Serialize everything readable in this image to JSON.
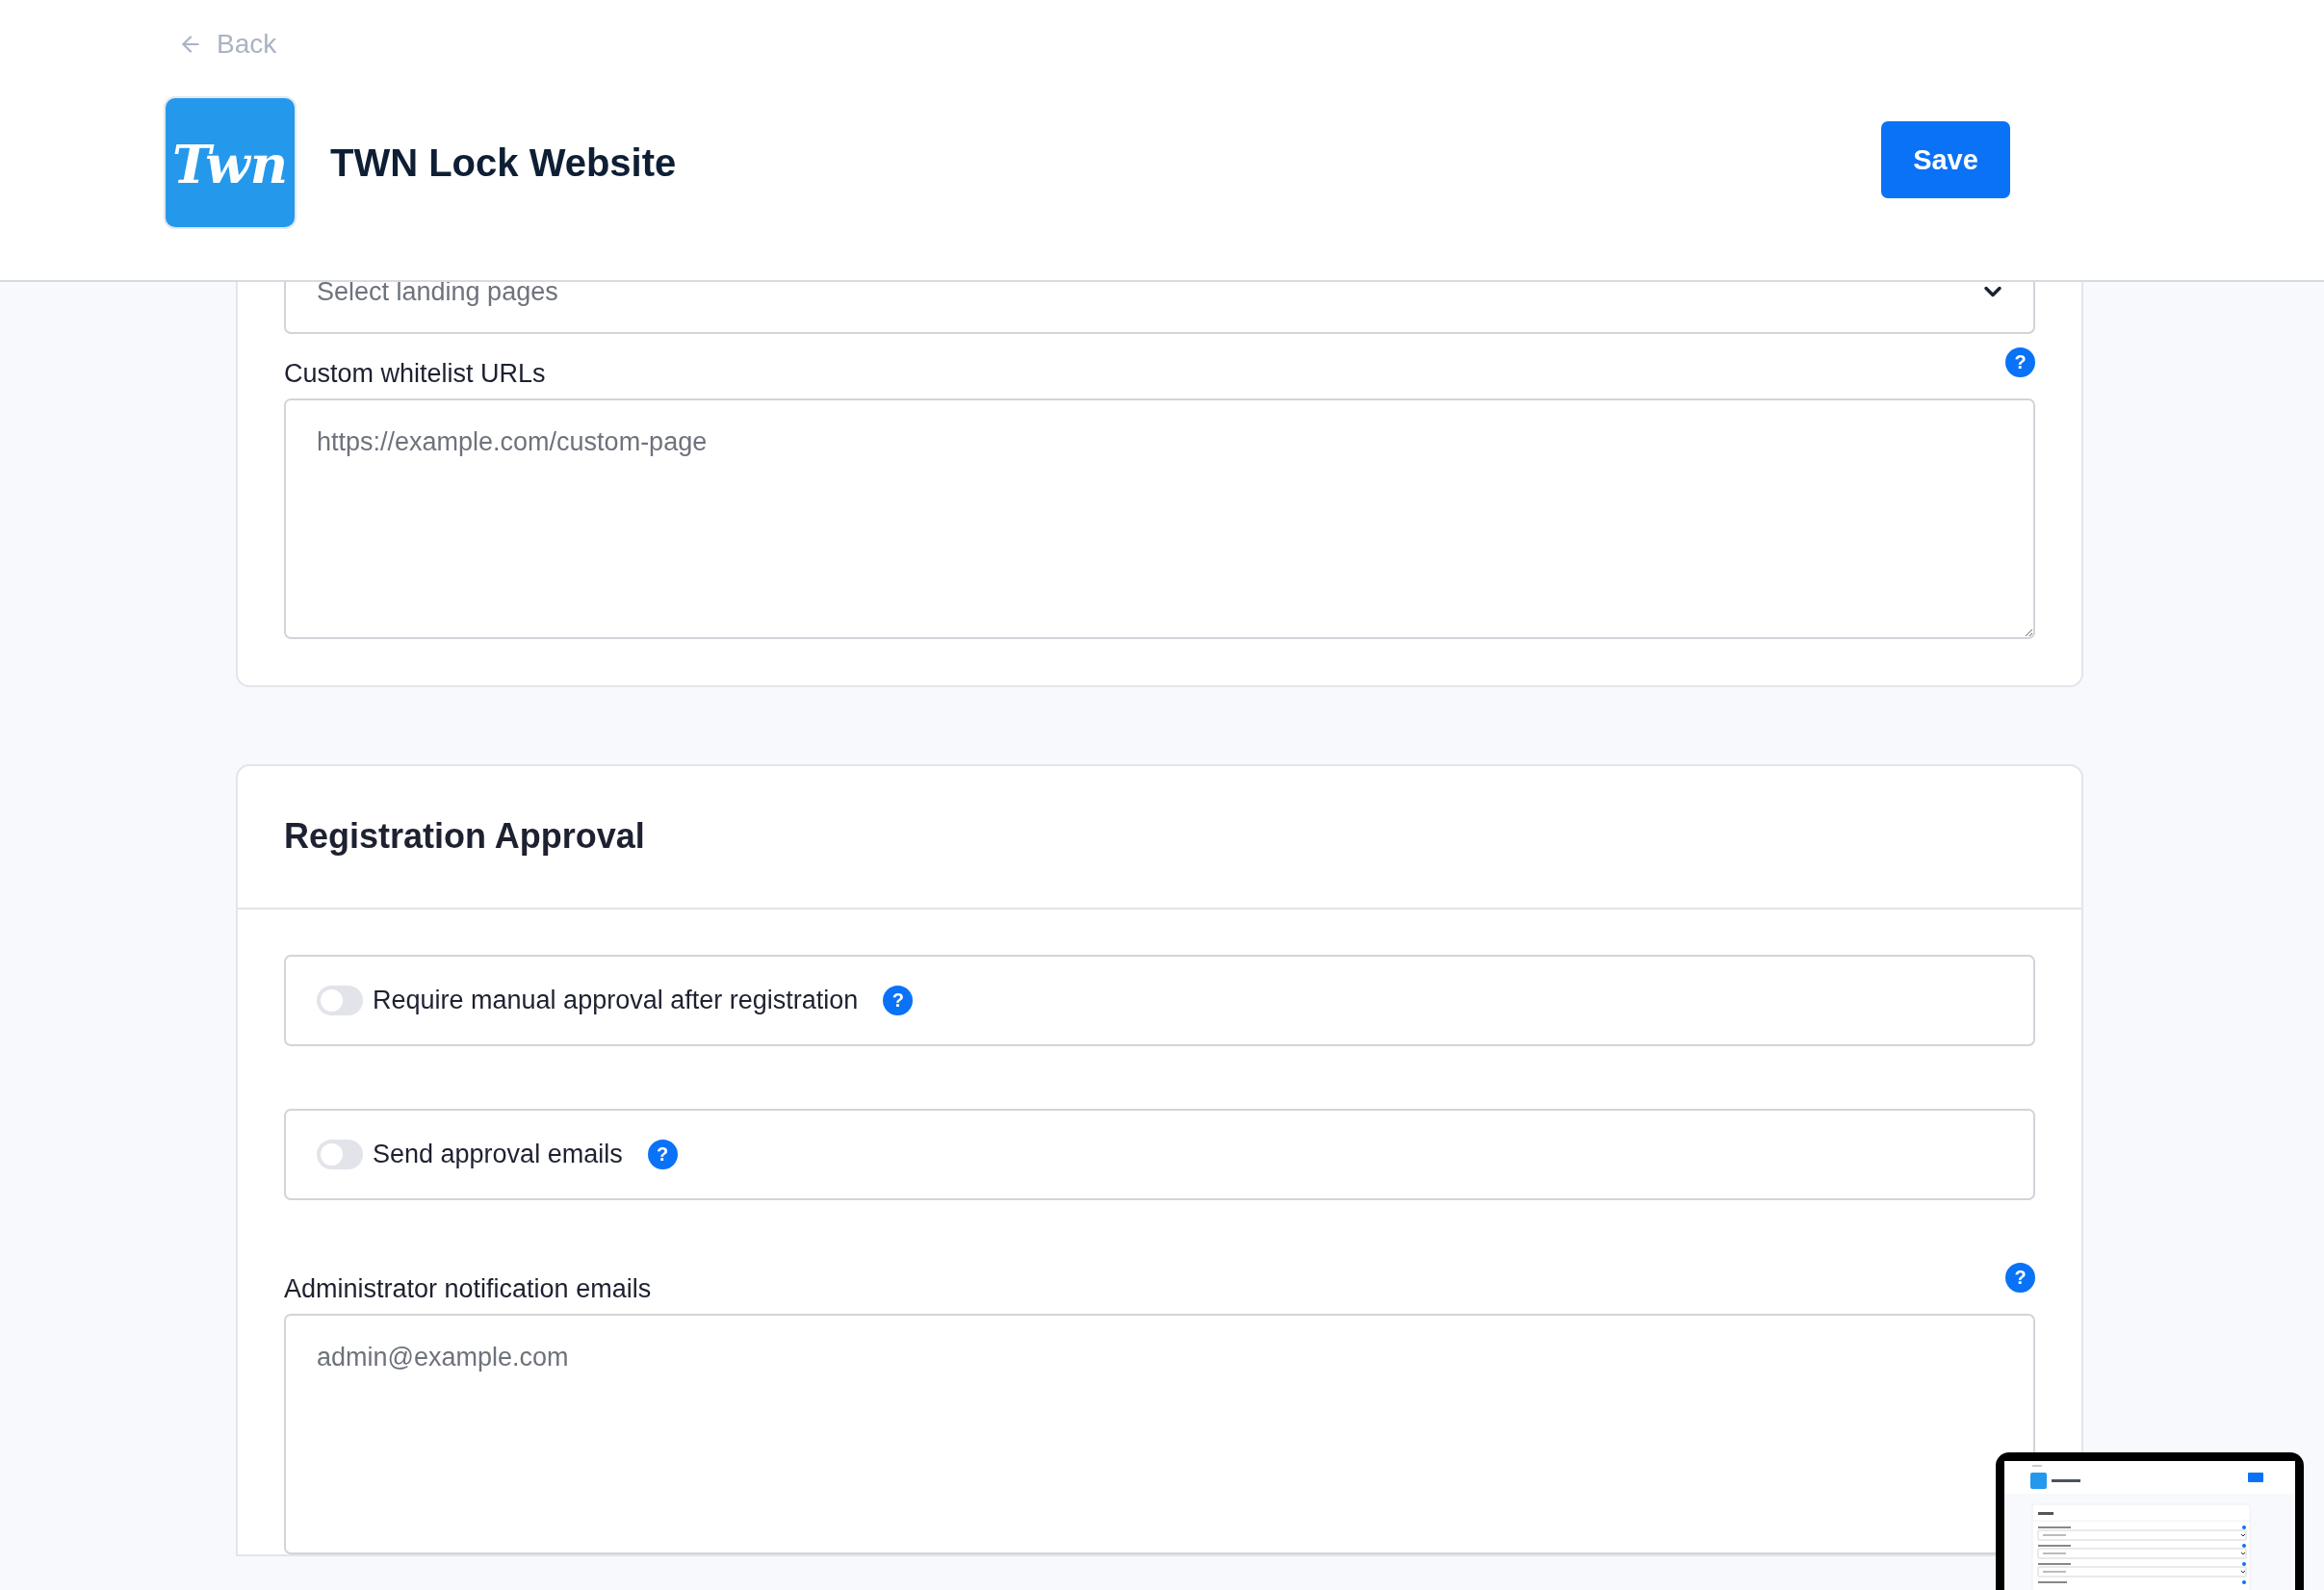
{
  "header": {
    "back": "Back",
    "logo": "Twn",
    "title": "TWN Lock Website",
    "save": "Save"
  },
  "whitelist_card": {
    "select": {
      "placeholder": "Select landing pages"
    },
    "field": {
      "label": "Custom whitelist URLs",
      "help": "?",
      "placeholder": "https://example.com/custom-page"
    }
  },
  "registration_card": {
    "title": "Registration Approval",
    "toggles": [
      {
        "label": "Require manual approval after registration",
        "help": "?",
        "on": false
      },
      {
        "label": "Send approval emails",
        "help": "?",
        "on": false
      }
    ],
    "field": {
      "label": "Administrator notification emails",
      "help": "?",
      "placeholder": "admin@example.com"
    }
  }
}
